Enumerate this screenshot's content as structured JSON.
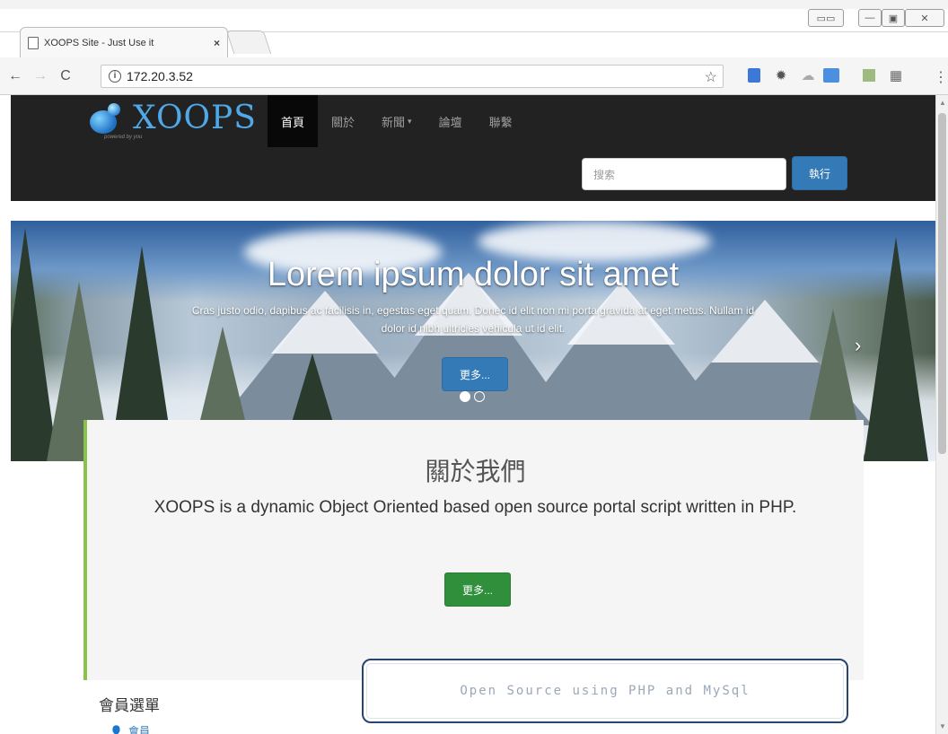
{
  "browser": {
    "tab_title": "XOOPS Site - Just Use it",
    "tab_close": "×",
    "url": "172.20.3.52",
    "info_glyph": "i",
    "back_glyph": "←",
    "forward_glyph": "→",
    "reload_glyph": "C",
    "star_glyph": "☆",
    "menu_glyph": "⋮",
    "window_controls": {
      "minimize": "—",
      "maximize": "▣",
      "close": "✕"
    }
  },
  "site": {
    "logo_text": "XOOPS",
    "logo_tagline": "powered by you",
    "nav": [
      {
        "label": "首頁",
        "active": true
      },
      {
        "label": "關於",
        "active": false
      },
      {
        "label": "新聞",
        "active": false,
        "dropdown": true
      },
      {
        "label": "論壇",
        "active": false
      },
      {
        "label": "聯繫",
        "active": false
      }
    ],
    "caret": "▾",
    "search_placeholder": "搜索",
    "search_button": "執行"
  },
  "carousel": {
    "heading": "Lorem ipsum dolor sit amet",
    "text": "Cras justo odio, dapibus ac facilisis in, egestas eget quam. Donec id elit non mi porta gravida at eget metus. Nullam id dolor id nibh ultricies vehicula ut id elit.",
    "button": "更多...",
    "next_glyph": "›"
  },
  "about": {
    "title": "關於我們",
    "text": "XOOPS is a dynamic Object Oriented based open source portal script written in PHP.",
    "button": "更多..."
  },
  "member_menu": {
    "title": "會員選單",
    "first_item": "會員"
  },
  "banner": {
    "text": "Open Source using PHP and MySql"
  },
  "colors": {
    "navbar_bg": "#222222",
    "primary_button": "#337ab7",
    "success_button": "#2f8f3a",
    "about_accent": "#8bc34a",
    "logo_blue": "#4fa8e8"
  }
}
